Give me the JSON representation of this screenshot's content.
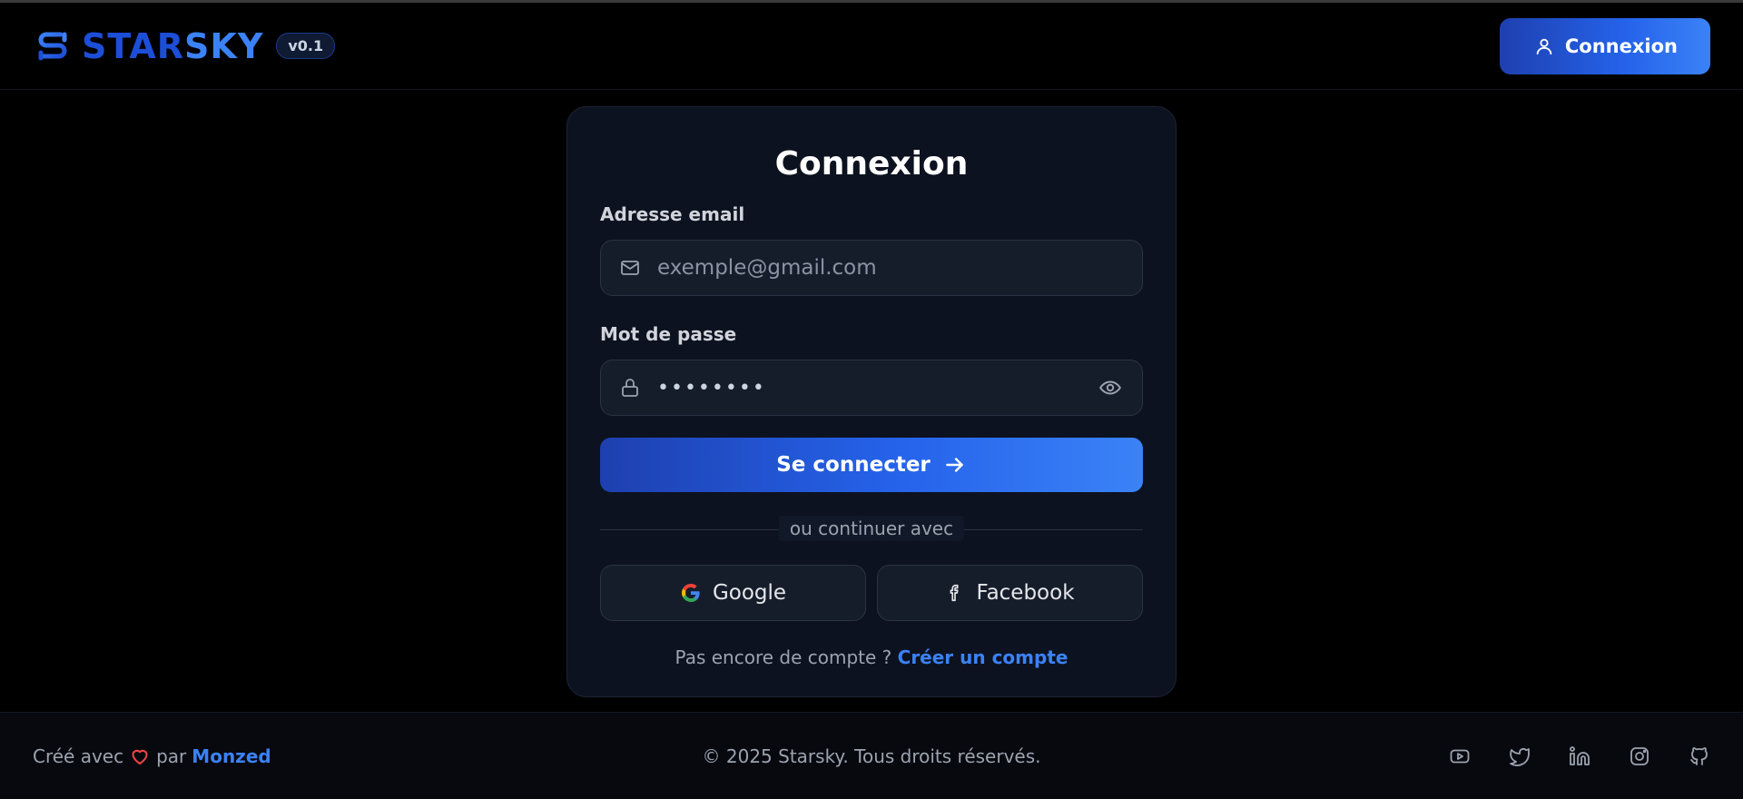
{
  "brand": {
    "name_part1": "STAR",
    "name_part2": "SKY",
    "version": "v0.1",
    "logo_icon": "s-logo-icon"
  },
  "header": {
    "login_label": "Connexion",
    "login_icon": "user-icon"
  },
  "card": {
    "title": "Connexion",
    "email_label": "Adresse email",
    "email_placeholder": "exemple@gmail.com",
    "email_icon": "mail-icon",
    "password_label": "Mot de passe",
    "password_value": "••••••••",
    "password_icon": "lock-icon",
    "toggle_icon": "eye-icon",
    "submit_label": "Se connecter",
    "submit_icon": "arrow-right-icon",
    "divider_text": "ou continuer avec",
    "google_label": "Google",
    "facebook_label": "Facebook",
    "no_account_text": "Pas encore de compte ?",
    "create_account_link": "Créer un compte"
  },
  "footer": {
    "made_with": "Créé avec",
    "by": "par",
    "author": "Monzed",
    "copyright": "© 2025 Starsky. Tous droits réservés.",
    "social_icons": [
      "youtube-icon",
      "twitter-icon",
      "linkedin-icon",
      "instagram-icon",
      "github-icon"
    ]
  },
  "colors": {
    "accent": "#3b82f6",
    "accent_dark": "#1e40af",
    "background": "#000000",
    "card_bg": "#0d1220",
    "heart": "#ef4444"
  }
}
